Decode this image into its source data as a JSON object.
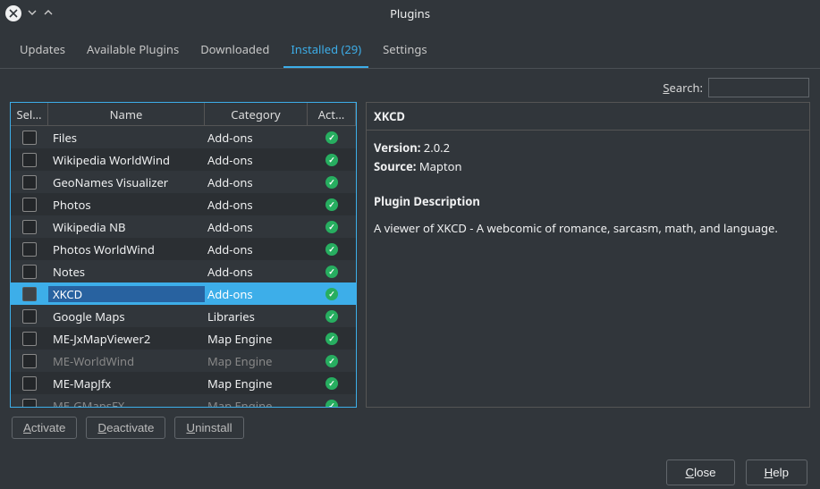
{
  "window_title": "Plugins",
  "tabs": {
    "updates": "Updates",
    "available": "Available Plugins",
    "downloaded": "Downloaded",
    "installed": "Installed (29)",
    "settings": "Settings"
  },
  "search_label": "Search:",
  "search_value": "",
  "columns": {
    "sel": "Sel…",
    "name": "Name",
    "cat": "Category",
    "act": "Act…"
  },
  "rows": [
    {
      "name": "Files",
      "cat": "Add-ons",
      "dim": false
    },
    {
      "name": "Wikipedia WorldWind",
      "cat": "Add-ons",
      "dim": false
    },
    {
      "name": "GeoNames Visualizer",
      "cat": "Add-ons",
      "dim": false
    },
    {
      "name": "Photos",
      "cat": "Add-ons",
      "dim": false
    },
    {
      "name": "Wikipedia NB",
      "cat": "Add-ons",
      "dim": false
    },
    {
      "name": "Photos WorldWind",
      "cat": "Add-ons",
      "dim": false
    },
    {
      "name": "Notes",
      "cat": "Add-ons",
      "dim": false
    },
    {
      "name": "XKCD",
      "cat": "Add-ons",
      "selected": true,
      "dim": false
    },
    {
      "name": "Google Maps",
      "cat": "Libraries",
      "dim": false
    },
    {
      "name": "ME-JxMapViewer2",
      "cat": "Map Engine",
      "dim": false
    },
    {
      "name": "ME-WorldWind",
      "cat": "Map Engine",
      "dim": true
    },
    {
      "name": "ME-MapJfx",
      "cat": "Map Engine",
      "dim": false
    },
    {
      "name": "ME-GMapsFX",
      "cat": "Map Engine",
      "dim": true
    }
  ],
  "action_buttons": {
    "activate": "Activate",
    "deactivate": "Deactivate",
    "uninstall": "Uninstall"
  },
  "details": {
    "title": "XKCD",
    "version_label": "Version:",
    "version": "2.0.2",
    "source_label": "Source:",
    "source": "Mapton",
    "desc_header": "Plugin Description",
    "desc": "A viewer of XKCD - A webcomic of romance, sarcasm, math, and language."
  },
  "footer": {
    "close": "Close",
    "help": "Help"
  }
}
